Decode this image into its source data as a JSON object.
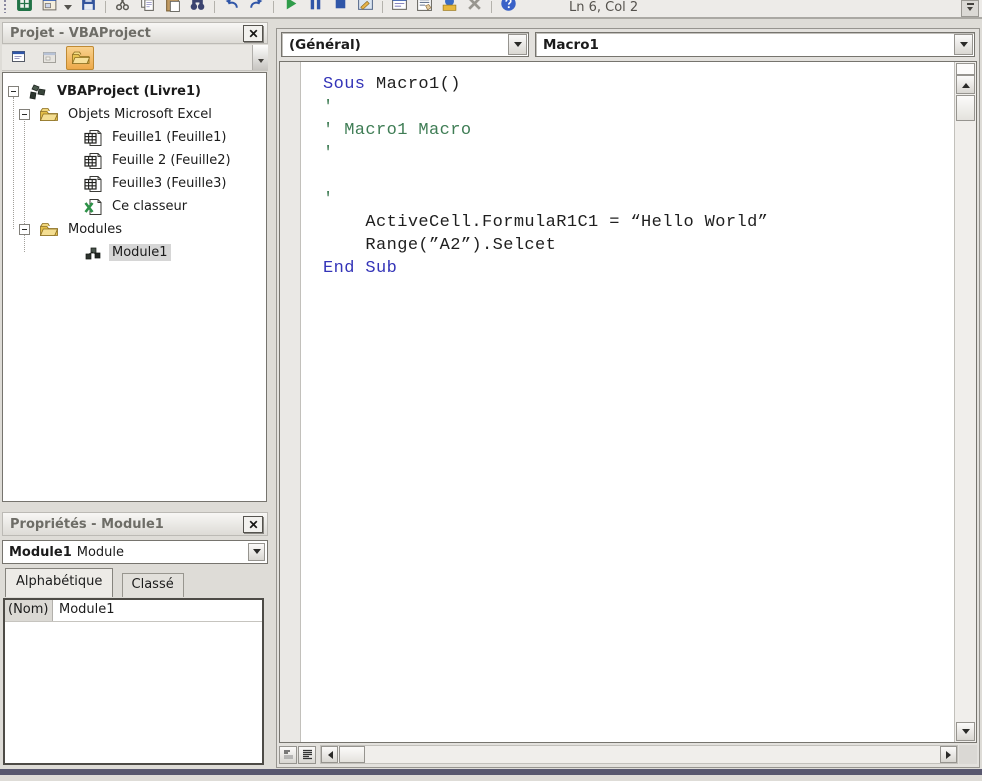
{
  "toolbar": {
    "status": "Ln 6, Col 2",
    "icon_groups": [
      [
        "excel",
        "insert-userform",
        "save"
      ],
      [
        "cut",
        "copy",
        "paste",
        "find"
      ],
      [
        "undo",
        "redo"
      ],
      [
        "run",
        "break",
        "reset",
        "design-mode"
      ],
      [
        "project-explorer",
        "properties-window",
        "object-browser",
        "toolbox"
      ],
      [
        "help"
      ]
    ]
  },
  "project_panel": {
    "title": "Projet - VBAProject",
    "buttons": [
      "view-code",
      "view-object",
      "toggle-folders"
    ],
    "tree": [
      {
        "label": "VBAProject (Livre1)",
        "level": 0,
        "icon": "project",
        "expand": true,
        "bold": true
      },
      {
        "label": "Objets Microsoft Excel",
        "level": 1,
        "icon": "folder",
        "expand": true
      },
      {
        "label": "Feuille1 (Feuille1)",
        "level": 2,
        "icon": "worksheet"
      },
      {
        "label": "Feuille 2 (Feuille2)",
        "level": 2,
        "icon": "worksheet"
      },
      {
        "label": "Feuille3 (Feuille3)",
        "level": 2,
        "icon": "worksheet"
      },
      {
        "label": "Ce classeur",
        "level": 2,
        "icon": "workbook"
      },
      {
        "label": "Modules",
        "level": 1,
        "icon": "folder",
        "expand": true
      },
      {
        "label": "Module1",
        "level": 2,
        "icon": "module",
        "selected": true
      }
    ]
  },
  "properties_panel": {
    "title": "Propriétés - Module1",
    "object_name": "Module1",
    "object_type": "Module",
    "tabs": [
      {
        "label": "Alphabétique",
        "active": true
      },
      {
        "label": "Classé",
        "active": false
      }
    ],
    "rows": [
      {
        "name": "(Nom)",
        "value": "Module1"
      }
    ]
  },
  "code_window": {
    "object_dropdown": "(Général)",
    "procedure_dropdown": "Macro1",
    "lines": [
      [
        [
          "kw",
          "Sous"
        ],
        [
          "n",
          " Macro1()"
        ]
      ],
      [
        [
          "cm",
          "'"
        ]
      ],
      [
        [
          "cm",
          "' Macro1 Macro"
        ]
      ],
      [
        [
          "cm",
          "'"
        ]
      ],
      [],
      [
        [
          "cm",
          "'"
        ]
      ],
      [
        [
          "n",
          "    ActiveCell.FormulaR1C1 = “Hello World”"
        ]
      ],
      [
        [
          "n",
          "    Range(”A2”).Selcet"
        ]
      ],
      [
        [
          "kw",
          "End Sub"
        ]
      ]
    ]
  },
  "colors": {
    "keyword_blue": "#3434b8",
    "comment_green": "#3f7d55",
    "code_black": "#1f1f1f",
    "folder_button_highlight": "#eda94a",
    "tree_selection": "#d6d6d6",
    "panel_title_text": "#6e6d67",
    "status_text": "#55524d",
    "window_bottom_edge": "#59586f"
  }
}
